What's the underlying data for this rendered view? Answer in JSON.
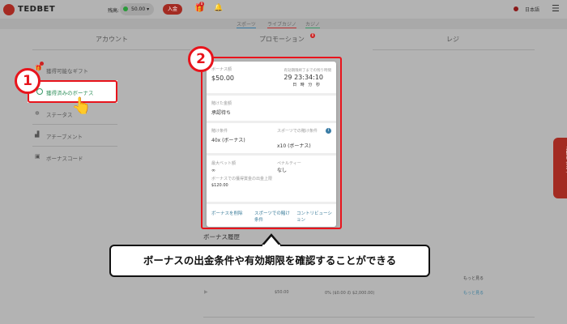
{
  "header": {
    "brand": "TEDBET",
    "balance_label": "残高:",
    "balance": "50.00",
    "deposit": "入金",
    "gift_badge": "0",
    "language": "日本語"
  },
  "subnav": [
    "スポーツ",
    "ライブカジノ",
    "カジノ"
  ],
  "tabs": {
    "account": "アカウント",
    "promotions": "プロモーション",
    "promotions_badge": "0",
    "cashier": "レジ"
  },
  "sidebar": [
    {
      "label": "獲得可能なギフト",
      "badge": "0"
    },
    {
      "label": "獲得済みのボーナス"
    },
    {
      "label": "ステータス"
    },
    {
      "label": "アチーブメント"
    },
    {
      "label": "ボーナスコード"
    }
  ],
  "card": {
    "bonus_amount_label": "ボーナス額",
    "bonus_amount": "$50.00",
    "expiry_label": "有効期限終了までの残り時間",
    "countdown": "29 23:34:10",
    "units": "日 時 分 秒",
    "wagered_label": "賭けた金額",
    "wagered": "承認待ち",
    "wager_req_label": "賭け条件",
    "wager_req": "40x (ボーナス)",
    "sports_req_label": "スポーツでの賭け条件",
    "sports_req": "x10 (ボーナス)",
    "max_bet_label": "最大ベット額",
    "max_bet": "∞",
    "penalty_label": "ペナルティー",
    "penalty": "なし",
    "max_withdraw_label": "ボーナスでの獲得賞金の出金上限",
    "max_withdraw": "$120.00",
    "links": [
      "ボーナスを削除",
      "スポーツでの賭け条件",
      "コントリビューション"
    ]
  },
  "history": {
    "title": "ボーナス履歴",
    "more1": "もっと見る",
    "amount": "$50.00",
    "progress": "0% ($0.00 の $2,000.00)",
    "more2": "もっと見る"
  },
  "contact": "お問い合わせ",
  "annotations": {
    "step1": "1",
    "step2": "2",
    "callout": "ボーナスの出金条件や有効期限を確認することができる"
  }
}
